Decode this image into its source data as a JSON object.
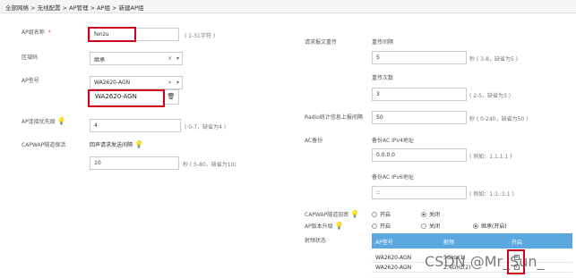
{
  "breadcrumb": "全部网络 > 无线配置 > AP管理 > AP组 > 新建AP组",
  "left": {
    "name_label": "AP组名称",
    "name_required": "*",
    "name_value": "fenzu",
    "name_hint": "( 1-31字符 )",
    "region_label": "区域码",
    "region_value": "继承",
    "model_label": "AP型号",
    "model_value": "WA2620-AGN",
    "model_option": "WA2620-AGN",
    "priority_label": "AP连接优先级",
    "priority_value": "4",
    "priority_hint": "( 0-7，缺省为4 )",
    "capwap_label": "CAPWAP隧道保活",
    "echo_label": "回声请求发送间隔",
    "echo_value": "10",
    "echo_hint": "秒 ( 5-80，缺省为10)"
  },
  "right": {
    "retrans_label": "请求报文重传",
    "retrans_interval_label": "重传间隔",
    "retrans_interval_value": "5",
    "retrans_interval_hint": "秒 ( 3-8，缺省为5 )",
    "retrans_count_label": "重传次数",
    "retrans_count_value": "3",
    "retrans_count_hint": "( 2-5，缺省为3 )",
    "radio_stats_label": "Radio统计信息上报间隔",
    "radio_stats_value": "50",
    "radio_stats_hint": "秒 ( 0-240，缺省为50 )",
    "ac_backup_label": "AC备份",
    "ipv4_label": "备份AC IPv4地址",
    "ipv4_value": "0.0.0.0",
    "ipv4_hint": "( 例如：1.1.1.1 )",
    "ipv6_label": "备份AC IPv6地址",
    "ipv6_value": "::",
    "ipv6_hint": "( 例如：1:1::1:1 )",
    "capwap_encrypt_label": "CAPWAP隧道加密",
    "capwap_encrypt_on": "开启",
    "capwap_encrypt_off": "关闭",
    "upgrade_label": "AP版本升级",
    "upgrade_on": "开启",
    "upgrade_off": "关闭",
    "upgrade_inherit": "继承(开启)",
    "radio_state_label": "射频状态",
    "table_headers": [
      "AP型号",
      "射频",
      "开启"
    ],
    "table_rows": [
      {
        "model": "WA2620-AGN",
        "radio": "5GHz(1)"
      },
      {
        "model": "WA2620-AGN",
        "radio": "2.4GHz(2)"
      }
    ]
  },
  "watermark": "CSDN @Mr_Sun_",
  "icons": {
    "clear": "×",
    "caret": "▾",
    "bulb": "💡",
    "trash": "🗑"
  }
}
